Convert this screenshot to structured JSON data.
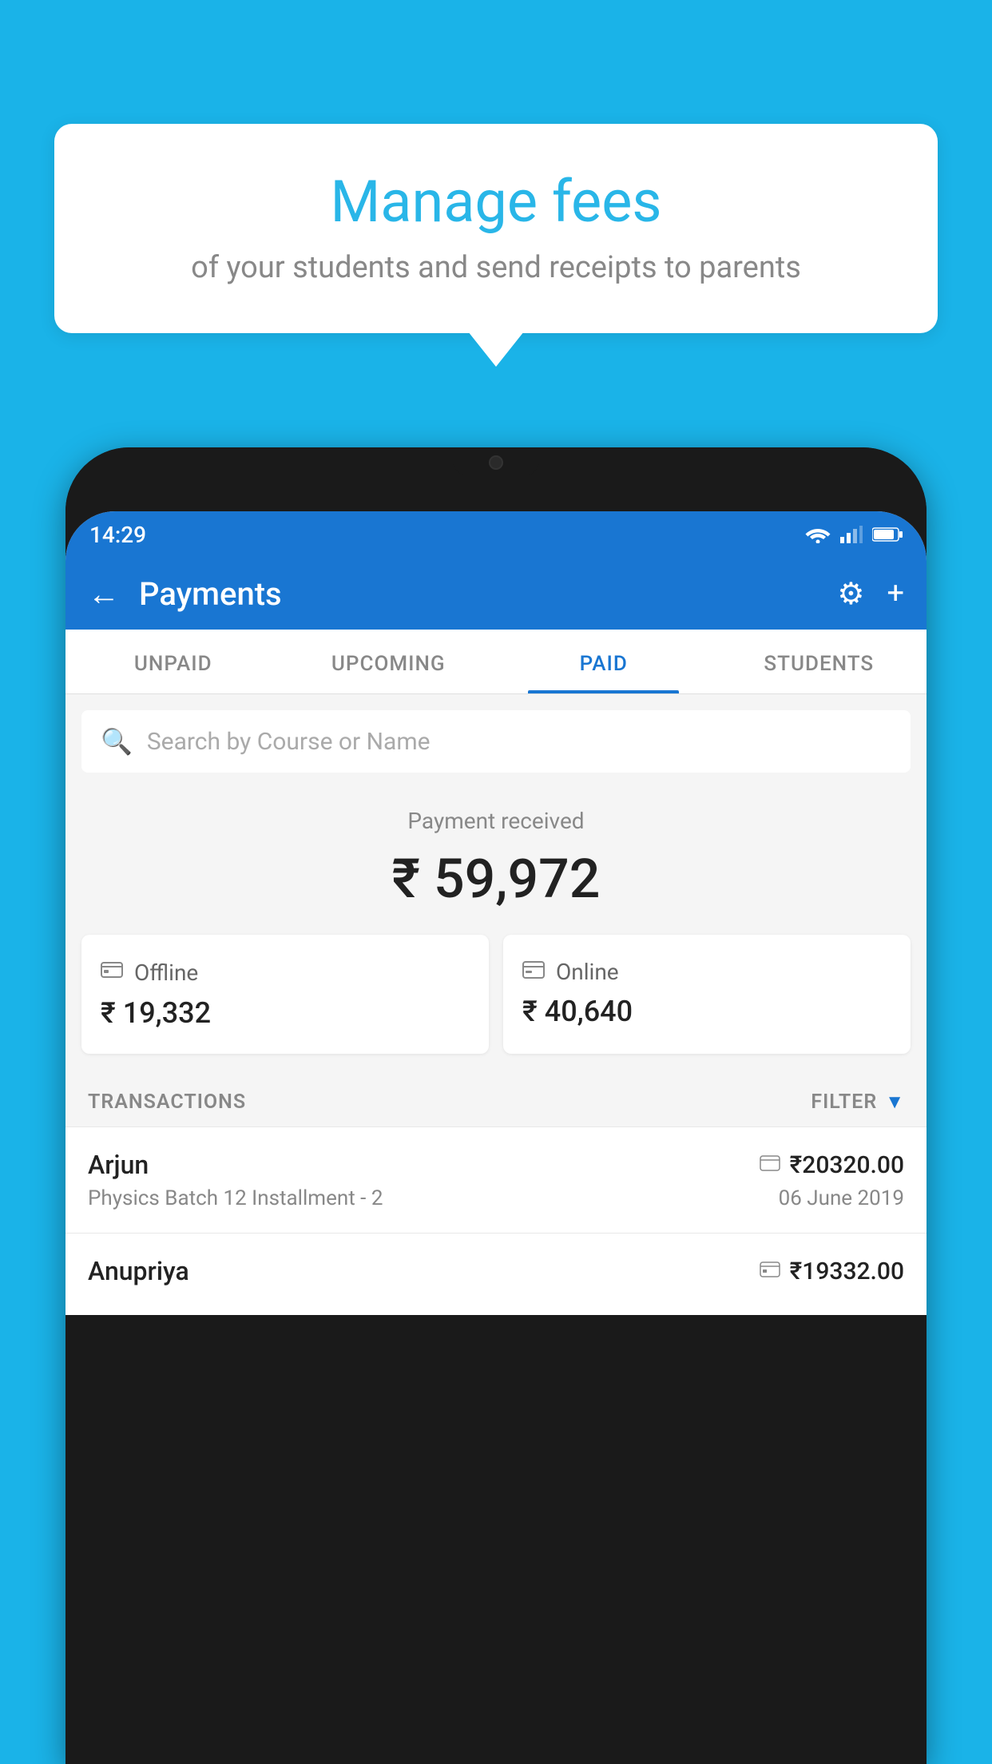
{
  "page": {
    "background_color": "#1ab3e8"
  },
  "speech_bubble": {
    "title": "Manage fees",
    "subtitle": "of your students and send receipts to parents"
  },
  "status_bar": {
    "time": "14:29"
  },
  "header": {
    "title": "Payments",
    "back_label": "←",
    "settings_label": "⚙",
    "add_label": "+"
  },
  "tabs": [
    {
      "id": "unpaid",
      "label": "UNPAID",
      "active": false
    },
    {
      "id": "upcoming",
      "label": "UPCOMING",
      "active": false
    },
    {
      "id": "paid",
      "label": "PAID",
      "active": true
    },
    {
      "id": "students",
      "label": "STUDENTS",
      "active": false
    }
  ],
  "search": {
    "placeholder": "Search by Course or Name"
  },
  "payment_received": {
    "label": "Payment received",
    "amount": "₹ 59,972"
  },
  "payment_cards": [
    {
      "type": "Offline",
      "amount": "₹ 19,332",
      "icon": "offline"
    },
    {
      "type": "Online",
      "amount": "₹ 40,640",
      "icon": "online"
    }
  ],
  "transactions_section": {
    "label": "TRANSACTIONS",
    "filter_label": "FILTER"
  },
  "transactions": [
    {
      "name": "Arjun",
      "type_icon": "card",
      "amount": "₹20320.00",
      "description": "Physics Batch 12 Installment - 2",
      "date": "06 June 2019"
    },
    {
      "name": "Anupriya",
      "type_icon": "offline",
      "amount": "₹19332.00",
      "description": "",
      "date": ""
    }
  ]
}
